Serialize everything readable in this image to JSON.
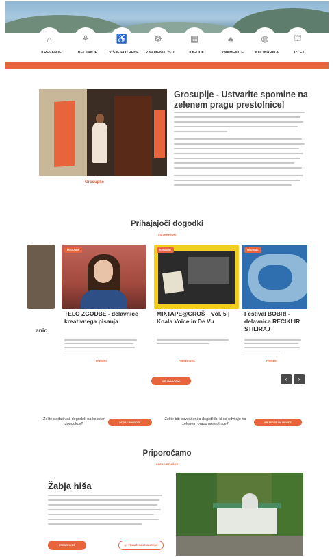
{
  "nav": {
    "items": [
      {
        "label": "KREVANJE",
        "icon": "bed-icon",
        "glyph": "⌂"
      },
      {
        "label": "BELJANJE",
        "icon": "utensils-icon",
        "glyph": "⚘"
      },
      {
        "label": "VIŠJE POTREBE",
        "icon": "walker-icon",
        "glyph": "♿"
      },
      {
        "label": "ZNAMENITOSTI",
        "icon": "landmark-icon",
        "glyph": "☸"
      },
      {
        "label": "DOGODKI",
        "icon": "calendar-icon",
        "glyph": "▦"
      },
      {
        "label": "ZNAMENITE",
        "icon": "tree-icon",
        "glyph": "♣"
      },
      {
        "label": "KULINARIKA",
        "icon": "globe-icon",
        "glyph": "◍"
      },
      {
        "label": "IZLETI",
        "icon": "bag-icon",
        "glyph": "⛫"
      }
    ]
  },
  "intro": {
    "title": "Grosuplje - Ustvarite spomine na zelenem pragu prestolnice!",
    "caption": "Grosuplje"
  },
  "events": {
    "title": "Prihajajoči dogodki",
    "subtitle": "VSI DOGODKI",
    "partial_title": "anic",
    "cards": [
      {
        "badge": "DOGODEK",
        "title": "TELO ZGODBE - delavnice kreativnega pisanja",
        "link": "PREBERI"
      },
      {
        "badge": "KONCERT",
        "title": "MIXTAPE@GROŠ – vol. 5 | Koala Voice in De Vu",
        "link": "PREBERI VEČ"
      },
      {
        "badge": "FESTIVAL",
        "title": "Festival BOBRI - delavnica RECIKLIR STILIRAJ",
        "link": "PREBERI"
      }
    ],
    "more_button": "VSI DOGODKI",
    "prev": "‹",
    "next": "›"
  },
  "cta": {
    "left_text": "Želite dodati vaš dogodek na koledar dogodkov?",
    "left_button": "DODAJ DOGODEK",
    "right_text": "Želite biti obveščeni o dogodkih, ki se odvijajo na zelenem pragu prestolnice?",
    "right_button": "PRIJAVI SE NA NOVICE"
  },
  "recommend": {
    "title": "Priporočamo",
    "subtitle": "VSE IZLETNIŠKE",
    "item_title": "Žabja hiša",
    "primary_button": "PREBERI VEČ",
    "secondary_button": "PRIKAŽI NA ZEMLJEVIDU"
  },
  "colors": {
    "accent": "#e8643c",
    "text": "#333333"
  }
}
